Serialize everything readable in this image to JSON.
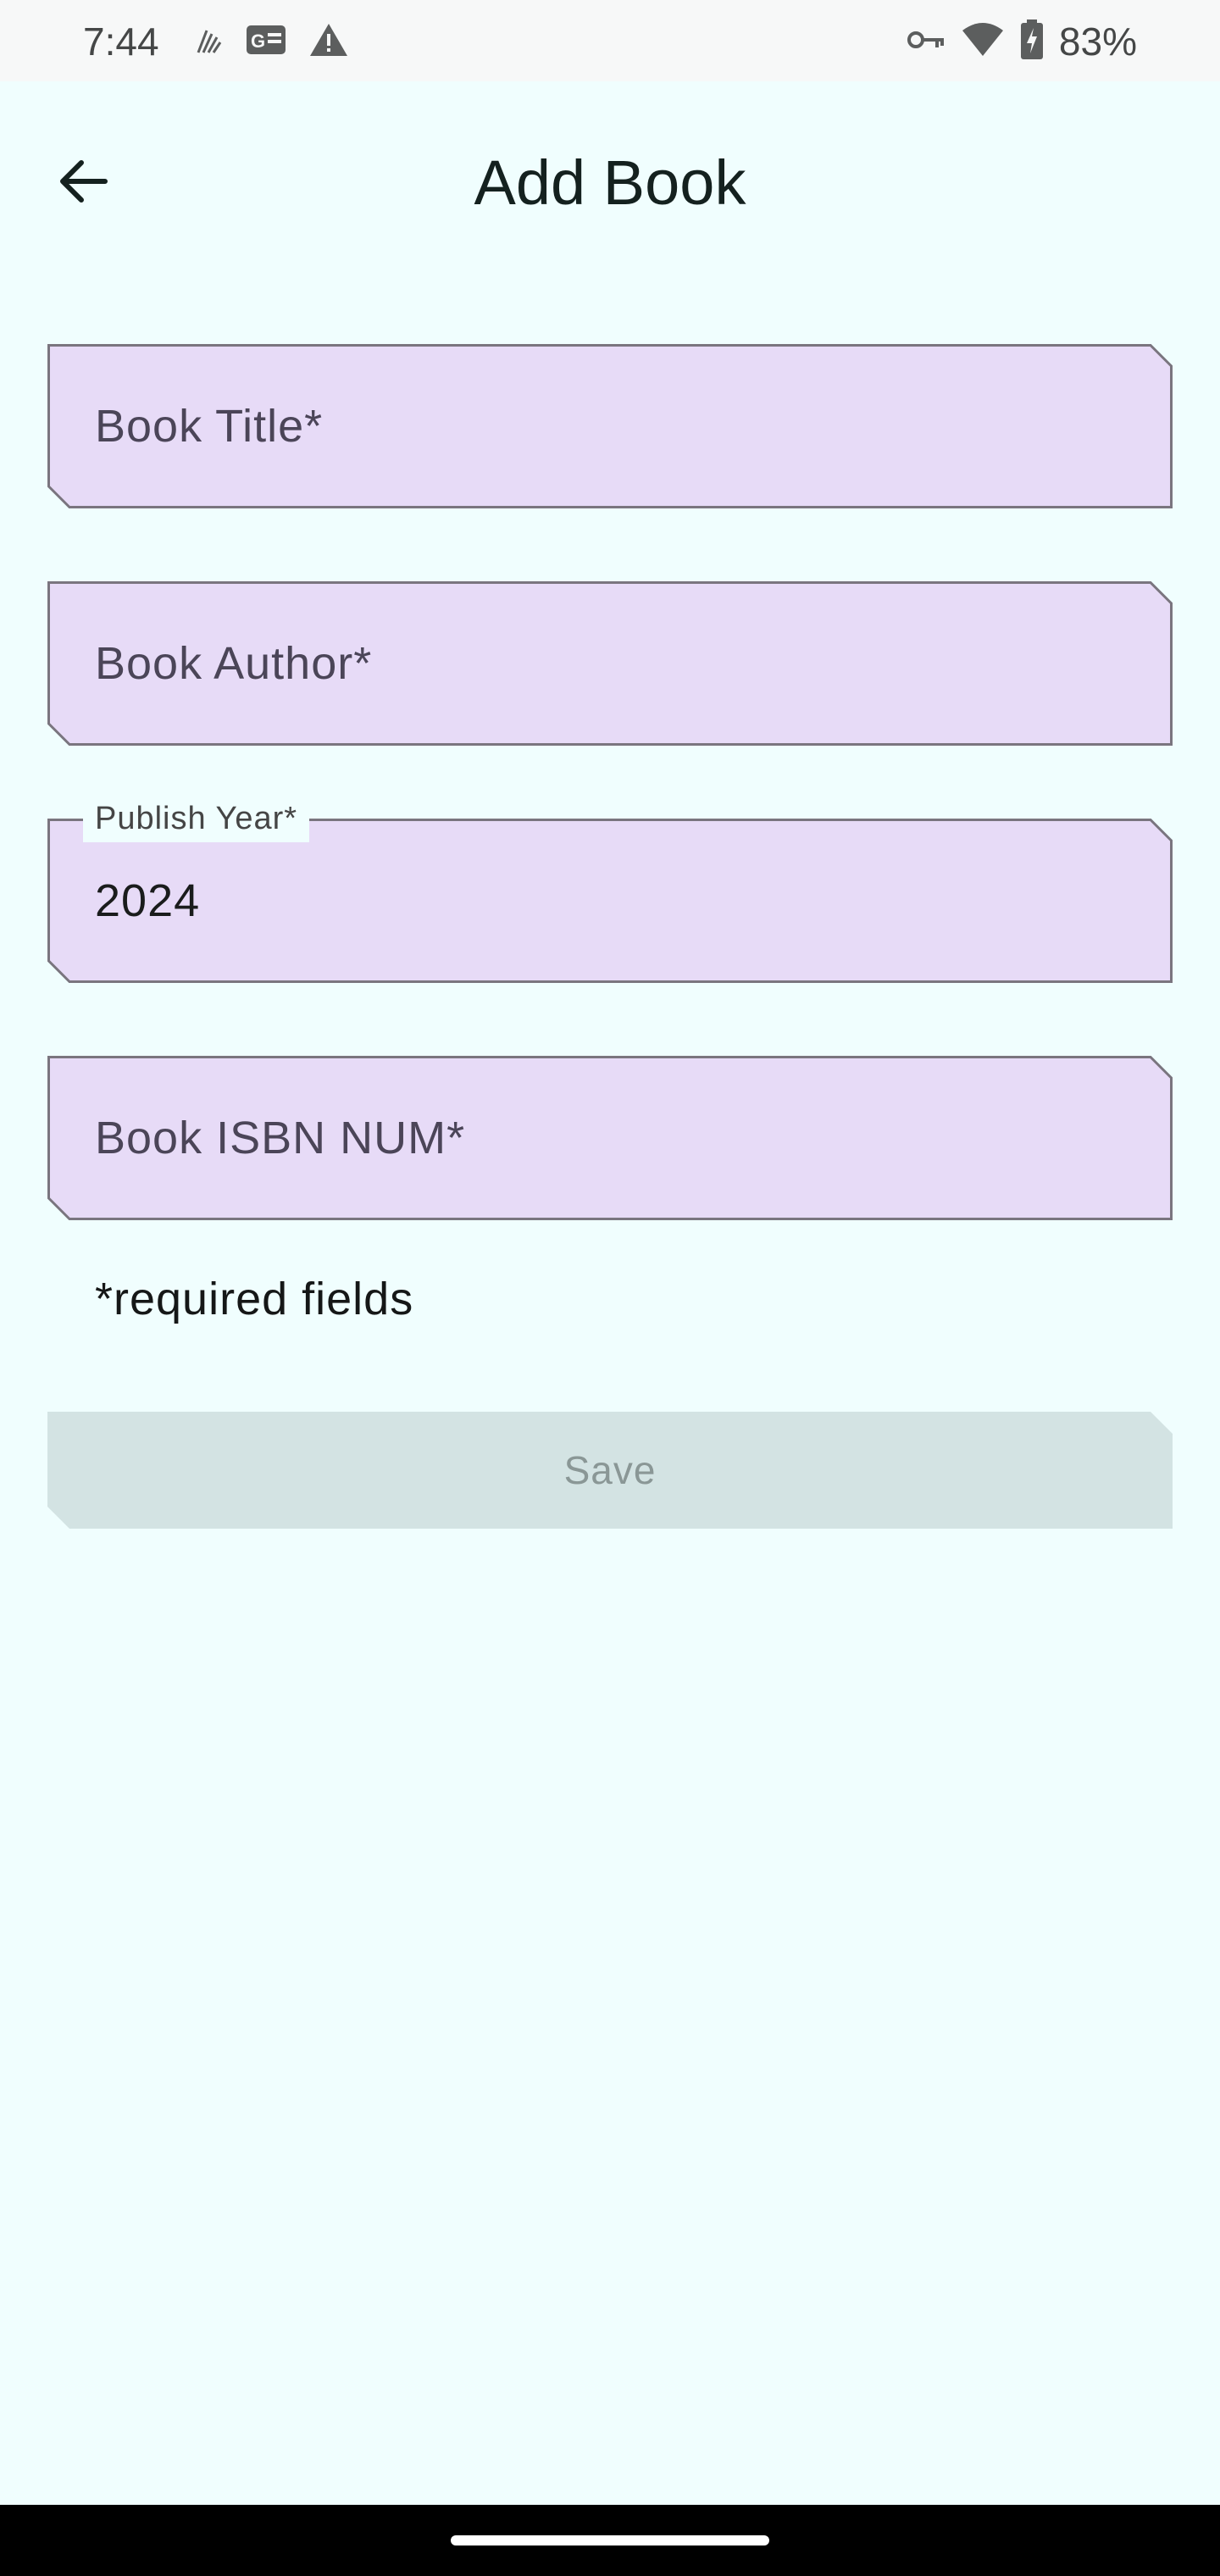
{
  "status_bar": {
    "time": "7:44",
    "battery": "83%",
    "left_icons": [
      "signal-scan-icon",
      "card-icon",
      "warning-icon"
    ],
    "right_icons": [
      "vpn-key-icon",
      "wifi-icon",
      "battery-charging-icon"
    ]
  },
  "header": {
    "back_icon": "arrow-back-icon",
    "title": "Add Book"
  },
  "form": {
    "title_field": {
      "placeholder": "Book Title*",
      "value": ""
    },
    "author_field": {
      "placeholder": "Book Author*",
      "value": ""
    },
    "year_field": {
      "label": "Publish Year*",
      "value": "2024"
    },
    "isbn_field": {
      "placeholder": "Book ISBN NUM*",
      "value": ""
    },
    "required_note": "*required fields",
    "save_label": "Save",
    "save_enabled": false
  },
  "colors": {
    "background": "#F0FEFE",
    "field_fill": "#E7DBF7",
    "field_border": "#7A757F",
    "button_disabled": "#D3E3E3"
  }
}
